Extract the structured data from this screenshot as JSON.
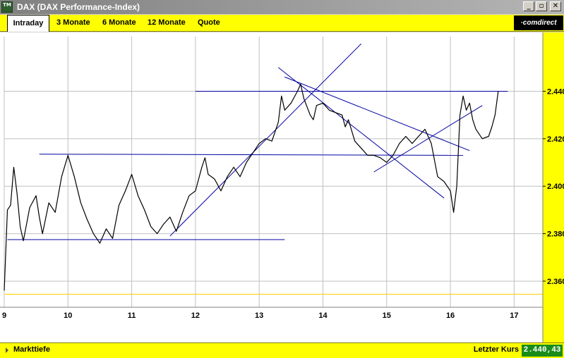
{
  "window": {
    "app_icon": "TM",
    "title": "DAX (DAX Performance-Index)",
    "controls": {
      "minimize": "_",
      "restore": "▫",
      "close": "✕"
    }
  },
  "tabs": [
    {
      "label": "Intraday",
      "active": true
    },
    {
      "label": "3 Monate",
      "active": false
    },
    {
      "label": "6 Monate",
      "active": false
    },
    {
      "label": "12 Monate",
      "active": false
    },
    {
      "label": "Quote",
      "active": false
    }
  ],
  "brand": "·comdirect",
  "status": {
    "left_label": "Markttiefe",
    "right_label": "Letzter Kurs",
    "last_price": "2.440,43"
  },
  "colors": {
    "accent": "#ffff00",
    "price_line": "#000000",
    "trend_lines": "#0000a0",
    "reference_line": "#ffd000",
    "grid": "#c0c0c0",
    "price_box": "#1a8c1a"
  },
  "chart_data": {
    "type": "line",
    "title": "",
    "xlabel": "",
    "ylabel": "",
    "x_ticks": [
      9,
      10,
      11,
      12,
      13,
      14,
      15,
      16,
      17
    ],
    "y_ticks": [
      2360,
      2380,
      2400,
      2420,
      2440
    ],
    "y_tick_labels": [
      "2.360",
      "2.380",
      "2.400",
      "2.420",
      "2.440"
    ],
    "xlim": [
      9,
      17.45
    ],
    "ylim": [
      2349,
      2463
    ],
    "grid": true,
    "series": [
      {
        "values": [
          [
            9.0,
            2356
          ],
          [
            9.05,
            2390
          ],
          [
            9.1,
            2392
          ],
          [
            9.15,
            2408
          ],
          [
            9.2,
            2397
          ],
          [
            9.25,
            2383
          ],
          [
            9.3,
            2377
          ],
          [
            9.4,
            2391
          ],
          [
            9.5,
            2396
          ],
          [
            9.55,
            2387
          ],
          [
            9.6,
            2380
          ],
          [
            9.7,
            2393
          ],
          [
            9.8,
            2389
          ],
          [
            9.9,
            2404
          ],
          [
            10.0,
            2413
          ],
          [
            10.1,
            2404
          ],
          [
            10.2,
            2393
          ],
          [
            10.3,
            2386
          ],
          [
            10.4,
            2380
          ],
          [
            10.5,
            2376
          ],
          [
            10.6,
            2382
          ],
          [
            10.7,
            2378
          ],
          [
            10.8,
            2392
          ],
          [
            10.9,
            2398
          ],
          [
            11.0,
            2405
          ],
          [
            11.1,
            2396
          ],
          [
            11.2,
            2390
          ],
          [
            11.3,
            2383
          ],
          [
            11.4,
            2380
          ],
          [
            11.5,
            2384
          ],
          [
            11.6,
            2387
          ],
          [
            11.7,
            2381
          ],
          [
            11.8,
            2389
          ],
          [
            11.9,
            2396
          ],
          [
            12.0,
            2398
          ],
          [
            12.1,
            2408
          ],
          [
            12.15,
            2412
          ],
          [
            12.2,
            2405
          ],
          [
            12.3,
            2403
          ],
          [
            12.4,
            2398
          ],
          [
            12.5,
            2404
          ],
          [
            12.6,
            2408
          ],
          [
            12.7,
            2404
          ],
          [
            12.8,
            2410
          ],
          [
            12.9,
            2414
          ],
          [
            13.0,
            2418
          ],
          [
            13.1,
            2420
          ],
          [
            13.2,
            2419
          ],
          [
            13.3,
            2427
          ],
          [
            13.35,
            2438
          ],
          [
            13.4,
            2432
          ],
          [
            13.5,
            2435
          ],
          [
            13.6,
            2440
          ],
          [
            13.65,
            2443
          ],
          [
            13.7,
            2437
          ],
          [
            13.8,
            2430
          ],
          [
            13.85,
            2428
          ],
          [
            13.9,
            2434
          ],
          [
            14.0,
            2435
          ],
          [
            14.1,
            2432
          ],
          [
            14.2,
            2431
          ],
          [
            14.3,
            2430
          ],
          [
            14.35,
            2425
          ],
          [
            14.4,
            2428
          ],
          [
            14.5,
            2419
          ],
          [
            14.6,
            2416
          ],
          [
            14.7,
            2413
          ],
          [
            14.8,
            2413
          ],
          [
            14.9,
            2412
          ],
          [
            15.0,
            2410
          ],
          [
            15.1,
            2413
          ],
          [
            15.2,
            2418
          ],
          [
            15.3,
            2421
          ],
          [
            15.4,
            2418
          ],
          [
            15.5,
            2421
          ],
          [
            15.6,
            2424
          ],
          [
            15.7,
            2418
          ],
          [
            15.8,
            2404
          ],
          [
            15.9,
            2402
          ],
          [
            16.0,
            2398
          ],
          [
            16.05,
            2389
          ],
          [
            16.1,
            2400
          ],
          [
            16.15,
            2430
          ],
          [
            16.2,
            2438
          ],
          [
            16.25,
            2432
          ],
          [
            16.3,
            2435
          ],
          [
            16.35,
            2428
          ],
          [
            16.4,
            2424
          ],
          [
            16.5,
            2420
          ],
          [
            16.6,
            2421
          ],
          [
            16.65,
            2425
          ],
          [
            16.7,
            2430
          ],
          [
            16.75,
            2440
          ]
        ]
      }
    ],
    "trend_lines": [
      {
        "from": [
          9.05,
          2377.5
        ],
        "to": [
          13.4,
          2377.5
        ]
      },
      {
        "from": [
          9.55,
          2413.5
        ],
        "to": [
          16.2,
          2413
        ]
      },
      {
        "from": [
          11.6,
          2379
        ],
        "to": [
          14.6,
          2460
        ]
      },
      {
        "from": [
          12.0,
          2440
        ],
        "to": [
          16.9,
          2440
        ]
      },
      {
        "from": [
          13.3,
          2450
        ],
        "to": [
          15.9,
          2395
        ]
      },
      {
        "from": [
          13.4,
          2446
        ],
        "to": [
          16.3,
          2415
        ]
      },
      {
        "from": [
          14.8,
          2406
        ],
        "to": [
          16.5,
          2434
        ]
      }
    ],
    "reference_lines": [
      {
        "y": 2354.5
      }
    ]
  }
}
